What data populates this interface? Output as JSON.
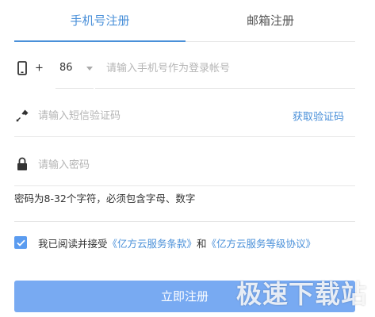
{
  "tabs": {
    "phone_register": "手机号注册",
    "email_register": "邮箱注册"
  },
  "phone_row": {
    "plus": "+",
    "country_code": "86",
    "placeholder": "请输入手机号作为登录帐号"
  },
  "sms_row": {
    "placeholder": "请输入短信验证码",
    "get_code_label": "获取验证码"
  },
  "password_row": {
    "placeholder": "请输入密码"
  },
  "password_hint": "密码为8-32个字符，必须包含字母、数字",
  "agreement": {
    "checked": true,
    "prefix": "我已阅读并接受",
    "terms_link": "《亿方云服务条款》",
    "and": "和",
    "sla_link": "《亿方云服务等级协议》"
  },
  "register_button": "立即注册",
  "watermark": "极速下载站",
  "icons": {
    "phone": "phone-icon",
    "key": "key-icon",
    "lock": "lock-icon",
    "caret": "chevron-down-icon",
    "check": "check-icon"
  },
  "colors": {
    "accent": "#4a90d9",
    "button": "#78aaf2",
    "checkbox": "#5b9cf0"
  }
}
